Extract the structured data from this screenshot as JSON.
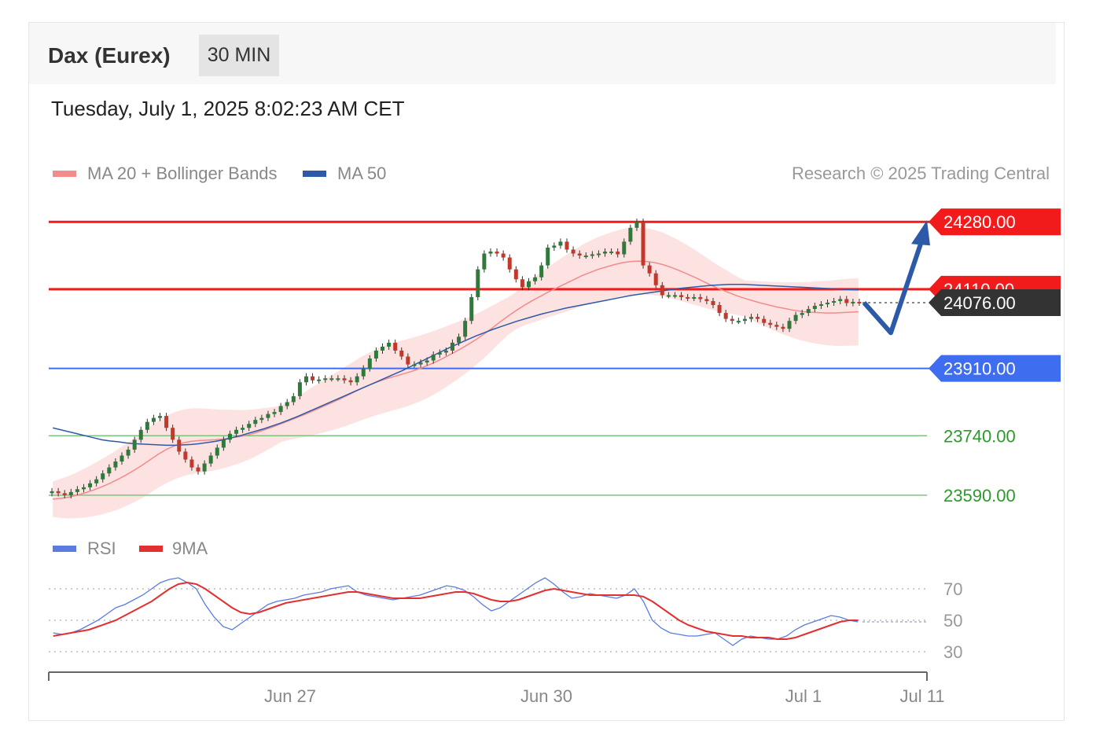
{
  "header": {
    "title": "Dax (Eurex)",
    "timeframe": "30 MIN"
  },
  "date": "Tuesday, July 1, 2025 8:02:23 AM CET",
  "legend": {
    "ma20": "MA 20 + Bollinger Bands",
    "ma50": "MA 50",
    "rsi": "RSI",
    "rsi_ma": "9MA"
  },
  "credit": "Research © 2025 Trading Central",
  "colors": {
    "resistance": "#f21b1b",
    "support": "#3f6df0",
    "target": "#2a9a2a",
    "current": "#333333",
    "ma50": "#2c5aa8",
    "arrow": "#2c5aa8",
    "bollinger": "#fde2e2",
    "up": "#2f7a3b",
    "down": "#c0392b"
  },
  "chart_data": {
    "type": "line",
    "instrument": "Dax (Eurex)",
    "interval": "30 MIN",
    "ylim": [
      23560,
      24330
    ],
    "x_ticks": [
      "Jun 27",
      "Jun 30",
      "Jul 1",
      "Jul 11"
    ],
    "levels": [
      {
        "label": "24280.00",
        "value": 24280,
        "kind": "resistance"
      },
      {
        "label": "24110.00",
        "value": 24110,
        "kind": "resistance"
      },
      {
        "label": "24076.00",
        "value": 24076,
        "kind": "current"
      },
      {
        "label": "23910.00",
        "value": 23910,
        "kind": "support"
      },
      {
        "label": "23740.00",
        "value": 23740,
        "kind": "target"
      },
      {
        "label": "23590.00",
        "value": 23590,
        "kind": "target"
      }
    ],
    "price_close": [
      23600,
      23595,
      23590,
      23598,
      23605,
      23610,
      23620,
      23630,
      23645,
      23660,
      23675,
      23690,
      23705,
      23730,
      23755,
      23775,
      23785,
      23790,
      23760,
      23730,
      23700,
      23680,
      23660,
      23650,
      23670,
      23690,
      23710,
      23730,
      23745,
      23755,
      23760,
      23770,
      23780,
      23785,
      23795,
      23800,
      23815,
      23825,
      23840,
      23875,
      23890,
      23880,
      23882,
      23885,
      23885,
      23885,
      23880,
      23875,
      23890,
      23910,
      23935,
      23955,
      23965,
      23975,
      23955,
      23940,
      23920,
      23920,
      23925,
      23930,
      23945,
      23950,
      23955,
      23975,
      23990,
      24030,
      24090,
      24160,
      24200,
      24205,
      24200,
      24190,
      24160,
      24135,
      24115,
      24130,
      24140,
      24170,
      24215,
      24220,
      24230,
      24210,
      24200,
      24195,
      24195,
      24198,
      24200,
      24205,
      24205,
      24198,
      24230,
      24265,
      24280,
      24170,
      24150,
      24120,
      24095,
      24095,
      24095,
      24090,
      24088,
      24090,
      24085,
      24080,
      24070,
      24050,
      24035,
      24030,
      24030,
      24035,
      24040,
      24035,
      24025,
      24020,
      24015,
      24010,
      24030,
      24045,
      24050,
      24060,
      24068,
      24072,
      24076,
      24080,
      24085,
      24075,
      24078,
      24076
    ],
    "ma20": [
      23580,
      23582,
      23585,
      23590,
      23596,
      23603,
      23611,
      23620,
      23630,
      23641,
      23653,
      23666,
      23680,
      23694,
      23706,
      23715,
      23722,
      23726,
      23728,
      23729,
      23730,
      23732,
      23735,
      23738,
      23742,
      23748,
      23755,
      23762,
      23770,
      23778,
      23786,
      23794,
      23803,
      23812,
      23821,
      23830,
      23840,
      23850,
      23860,
      23869,
      23877,
      23884,
      23890,
      23896,
      23902,
      23909,
      23917,
      23926,
      23936,
      23947,
      23958,
      23970,
      23983,
      23997,
      24012,
      24028,
      24043,
      24057,
      24070,
      24082,
      24093,
      24104,
      24114,
      24124,
      24134,
      24144,
      24152,
      24160,
      24166,
      24172,
      24177,
      24180,
      24181,
      24180,
      24177,
      24172,
      24165,
      24157,
      24148,
      24139,
      24129,
      24119,
      24110,
      24102,
      24094,
      24087,
      24081,
      24075,
      24070,
      24065,
      24061,
      24057,
      24054,
      24052,
      24051,
      24050,
      24050,
      24051,
      24052,
      24053
    ],
    "ma50": [
      23760,
      23755,
      23750,
      23745,
      23740,
      23735,
      23730,
      23727,
      23725,
      23722,
      23720,
      23719,
      23718,
      23717,
      23716,
      23716,
      23717,
      23718,
      23720,
      23723,
      23726,
      23730,
      23735,
      23740,
      23746,
      23752,
      23758,
      23765,
      23772,
      23780,
      23788,
      23797,
      23806,
      23815,
      23824,
      23833,
      23842,
      23851,
      23860,
      23869,
      23878,
      23887,
      23896,
      23905,
      23915,
      23925,
      23935,
      23945,
      23955,
      23965,
      23974,
      23983,
      23992,
      24000,
      24008,
      24015,
      24022,
      24029,
      24035,
      24041,
      24047,
      24052,
      24057,
      24062,
      24066,
      24070,
      24074,
      24078,
      24082,
      24086,
      24090,
      24094,
      24097,
      24100,
      24103,
      24106,
      24109,
      24112,
      24114,
      24116,
      24118,
      24120,
      24121,
      24122,
      24122,
      24122,
      24121,
      24120,
      24119,
      24118,
      24117,
      24116,
      24115,
      24114,
      24113,
      24112,
      24111,
      24110,
      24109,
      24108
    ],
    "projection": [
      24076,
      24000,
      24280
    ],
    "rsi": {
      "ylim": [
        20,
        80
      ],
      "levels": [
        70,
        50,
        30
      ],
      "labels": [
        "70",
        "50",
        "30"
      ],
      "rsi": [
        42,
        41,
        42,
        44,
        47,
        50,
        54,
        58,
        60,
        63,
        66,
        70,
        74,
        76,
        77,
        74,
        70,
        60,
        52,
        46,
        44,
        48,
        52,
        56,
        60,
        62,
        63,
        64,
        66,
        67,
        68,
        70,
        71,
        72,
        68,
        66,
        65,
        64,
        63,
        64,
        65,
        66,
        68,
        70,
        72,
        71,
        69,
        65,
        60,
        56,
        58,
        62,
        66,
        70,
        74,
        77,
        73,
        68,
        64,
        65,
        67,
        66,
        65,
        64,
        66,
        70,
        62,
        50,
        45,
        42,
        41,
        40,
        40,
        41,
        42,
        38,
        34,
        38,
        40,
        39,
        38,
        38,
        40,
        44,
        47,
        49,
        51,
        53,
        52,
        50,
        49
      ],
      "ma": [
        40,
        41,
        42,
        43,
        44,
        46,
        48,
        50,
        53,
        56,
        59,
        62,
        66,
        70,
        73,
        74,
        73,
        70,
        66,
        62,
        58,
        55,
        54,
        55,
        57,
        59,
        61,
        62,
        63,
        64,
        65,
        66,
        67,
        68,
        68,
        67,
        66,
        65,
        64,
        64,
        64,
        64,
        65,
        66,
        67,
        68,
        68,
        67,
        65,
        63,
        62,
        62,
        63,
        65,
        67,
        69,
        70,
        69,
        68,
        67,
        66,
        66,
        66,
        66,
        66,
        66,
        65,
        62,
        58,
        54,
        50,
        47,
        45,
        43,
        42,
        41,
        40,
        40,
        39,
        39,
        39,
        38,
        38,
        39,
        41,
        43,
        45,
        47,
        49,
        50,
        50
      ]
    }
  }
}
